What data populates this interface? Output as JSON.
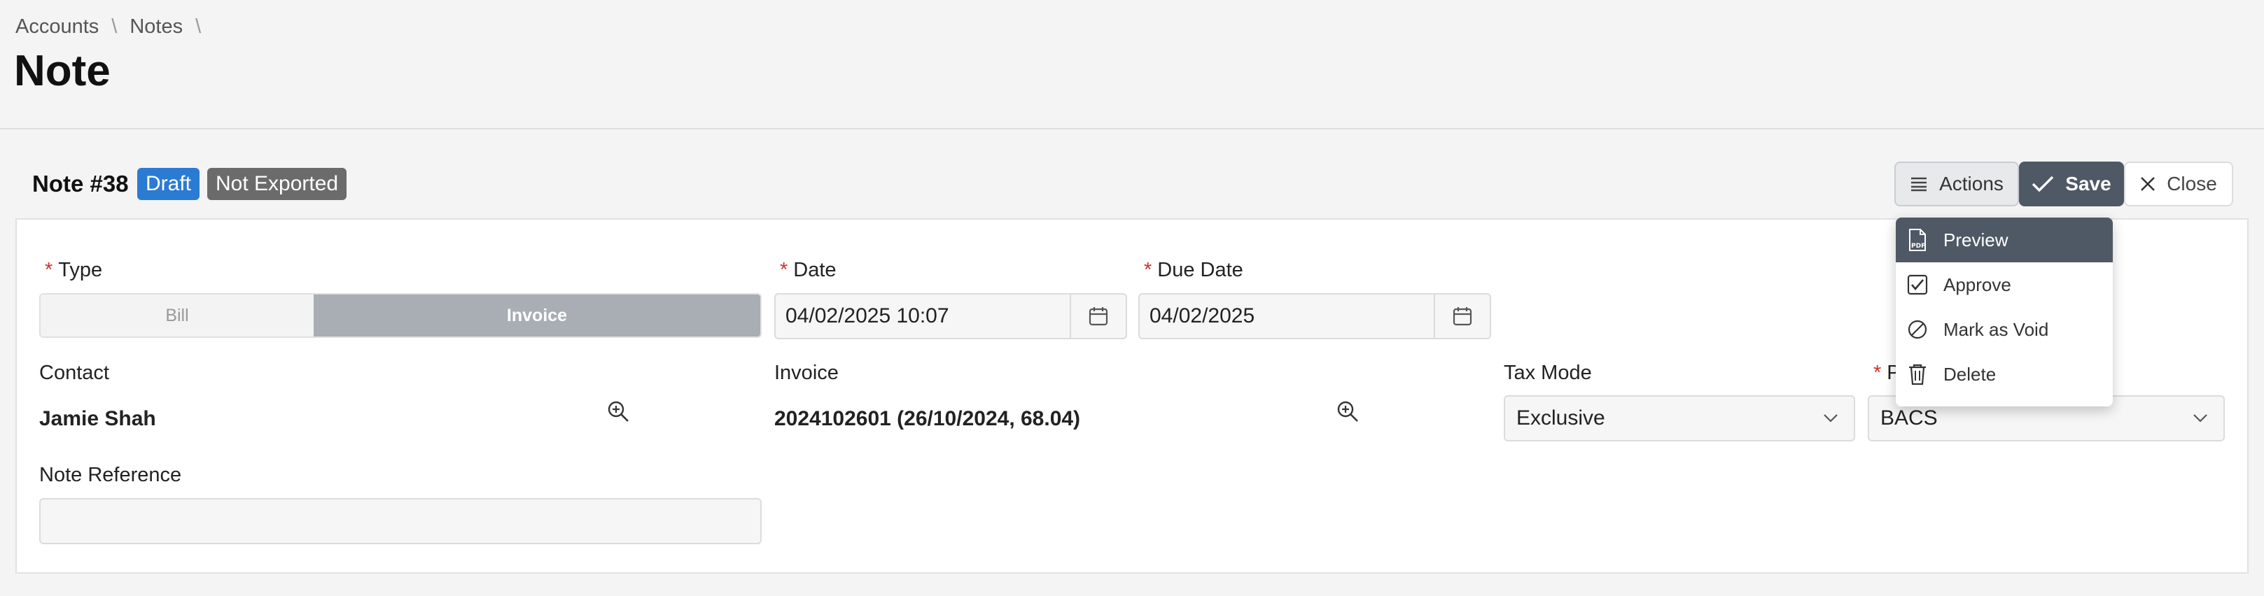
{
  "breadcrumb": {
    "items": [
      "Accounts",
      "Notes"
    ],
    "separator": "\\"
  },
  "page": {
    "title": "Note"
  },
  "note": {
    "title": "Note #38",
    "badges": {
      "status": "Draft",
      "export": "Not Exported"
    }
  },
  "toolbar": {
    "actions_label": "Actions",
    "save_label": "Save",
    "close_label": "Close"
  },
  "actions_menu": {
    "items": [
      {
        "label": "Preview",
        "icon": "pdf-icon"
      },
      {
        "label": "Approve",
        "icon": "checkbox-icon"
      },
      {
        "label": "Mark as Void",
        "icon": "void-icon"
      },
      {
        "label": "Delete",
        "icon": "trash-icon"
      }
    ]
  },
  "form": {
    "type": {
      "label": "Type",
      "options": [
        "Bill",
        "Invoice"
      ],
      "selected": "Invoice"
    },
    "date": {
      "label": "Date",
      "value": "04/02/2025 10:07"
    },
    "due_date": {
      "label": "Due Date",
      "value": "04/02/2025"
    },
    "contact": {
      "label": "Contact",
      "value": "Jamie Shah"
    },
    "invoice": {
      "label": "Invoice",
      "value": "2024102601 (26/10/2024, 68.04)"
    },
    "tax_mode": {
      "label": "Tax Mode",
      "value": "Exclusive"
    },
    "payment": {
      "label_visible": "P",
      "value": "BACS"
    },
    "note_reference": {
      "label": "Note Reference",
      "value": ""
    }
  },
  "colors": {
    "accent": "#2b7bd3",
    "primary_button": "#4f5965",
    "required": "#d0312d"
  }
}
